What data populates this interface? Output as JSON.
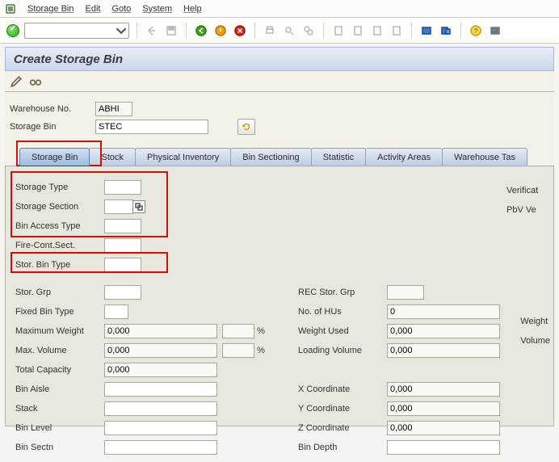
{
  "menubar": {
    "items": [
      "Storage Bin",
      "Edit",
      "Goto",
      "System",
      "Help"
    ]
  },
  "title": "Create Storage Bin",
  "header": {
    "warehouse_label": "Warehouse No.",
    "warehouse": "ABHI",
    "bin_label": "Storage Bin",
    "bin": "STEC"
  },
  "tabs": [
    "Storage Bin",
    "Stock",
    "Physical Inventory",
    "Bin Sectioning",
    "Statistic",
    "Activity Areas",
    "Warehouse Tas"
  ],
  "active_tab": 0,
  "section1": {
    "storage_type": {
      "label": "Storage Type",
      "value": ""
    },
    "storage_section": {
      "label": "Storage Section",
      "value": ""
    },
    "bin_access_type": {
      "label": "Bin Access Type",
      "value": ""
    },
    "fire_cont_sect": {
      "label": "Fire-Cont.Sect.",
      "value": ""
    },
    "stor_bin_type": {
      "label": "Stor. Bin Type",
      "value": ""
    }
  },
  "right_far": {
    "verification": "Verificat",
    "pbv": "PbV Ve"
  },
  "section2_left": {
    "stor_grp": {
      "label": "Stor. Grp",
      "value": ""
    },
    "fixed_bin_type": {
      "label": "Fixed Bin Type",
      "value": ""
    },
    "max_weight": {
      "label": "Maximum Weight",
      "value": "0,000"
    },
    "max_volume": {
      "label": "Max. Volume",
      "value": "0,000"
    },
    "total_capacity": {
      "label": "Total Capacity",
      "value": "0,000"
    },
    "bin_aisle": {
      "label": "Bin Aisle",
      "value": ""
    },
    "stack": {
      "label": "Stack",
      "value": ""
    },
    "bin_level": {
      "label": "Bin Level",
      "value": ""
    },
    "bin_sectn": {
      "label": "Bin Sectn",
      "value": ""
    }
  },
  "section2_right": {
    "rec_stor_grp": {
      "label": "REC Stor. Grp",
      "value": ""
    },
    "no_of_hus": {
      "label": "No. of HUs",
      "value": "0"
    },
    "weight_used": {
      "label": "Weight Used",
      "value": "0,000"
    },
    "loading_volume": {
      "label": "Loading Volume",
      "value": "0,000"
    },
    "x_coord": {
      "label": "X Coordinate",
      "value": "0,000"
    },
    "y_coord": {
      "label": "Y Coordinate",
      "value": "0,000"
    },
    "z_coord": {
      "label": "Z Coordinate",
      "value": "0,000"
    },
    "bin_depth": {
      "label": "Bin Depth",
      "value": ""
    }
  },
  "far_right_labels": {
    "weight": "Weight",
    "volume": "Volume"
  }
}
